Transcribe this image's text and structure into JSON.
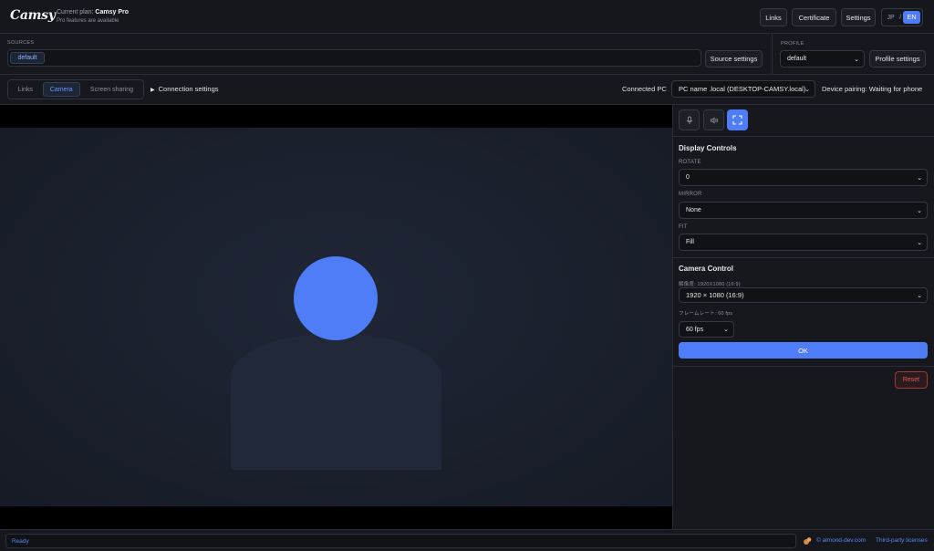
{
  "header": {
    "logo": "Camsy",
    "plan_label": "Current plan:",
    "plan_name": "Camsy Pro",
    "plan_sub": "Pro features are available",
    "buttons": {
      "links": "Links",
      "certificate": "Certificate",
      "settings": "Settings"
    },
    "lang": {
      "jp": "JP",
      "sep": "/",
      "en": "EN",
      "active": "EN"
    }
  },
  "sources": {
    "label": "SOURCES",
    "chips": [
      "default"
    ],
    "settings_button": "Source settings"
  },
  "profile": {
    "label": "PROFILE",
    "selected": "default",
    "settings_button": "Profile settings"
  },
  "tabs": {
    "items": [
      "Links",
      "Camera",
      "Screen sharing"
    ],
    "active": "Camera"
  },
  "connection": {
    "toggle": "Connection settings",
    "connected_pc_label": "Connected PC",
    "connected_pc_value": "PC name .local (DESKTOP-CAMSY.local)",
    "pairing": "Device pairing: Waiting for phone"
  },
  "panel": {
    "icons": [
      "microphone-icon",
      "speaker-icon",
      "fullscreen-icon"
    ],
    "display_controls": {
      "title": "Display Controls",
      "rotate_label": "ROTATE",
      "rotate_value": "0",
      "mirror_label": "MIRROR",
      "mirror_value": "None",
      "fit_label": "FIT",
      "fit_value": "Fill"
    },
    "camera_control": {
      "title": "Camera Control",
      "resolution_label": "解像度: 1920X1080 (16:9)",
      "resolution_value": "1920 × 1080 (16:9)",
      "fps_label": "フレームレート: 60 fps",
      "fps_value": "60 fps",
      "ok_button": "OK",
      "reset_button": "Reset"
    }
  },
  "status": {
    "text": "Ready",
    "copyright": "© almond-dev.com",
    "licenses": "Third-party licenses"
  },
  "colors": {
    "accent": "#4f7cf7",
    "background": "#16181d",
    "danger": "#e05a5a"
  }
}
